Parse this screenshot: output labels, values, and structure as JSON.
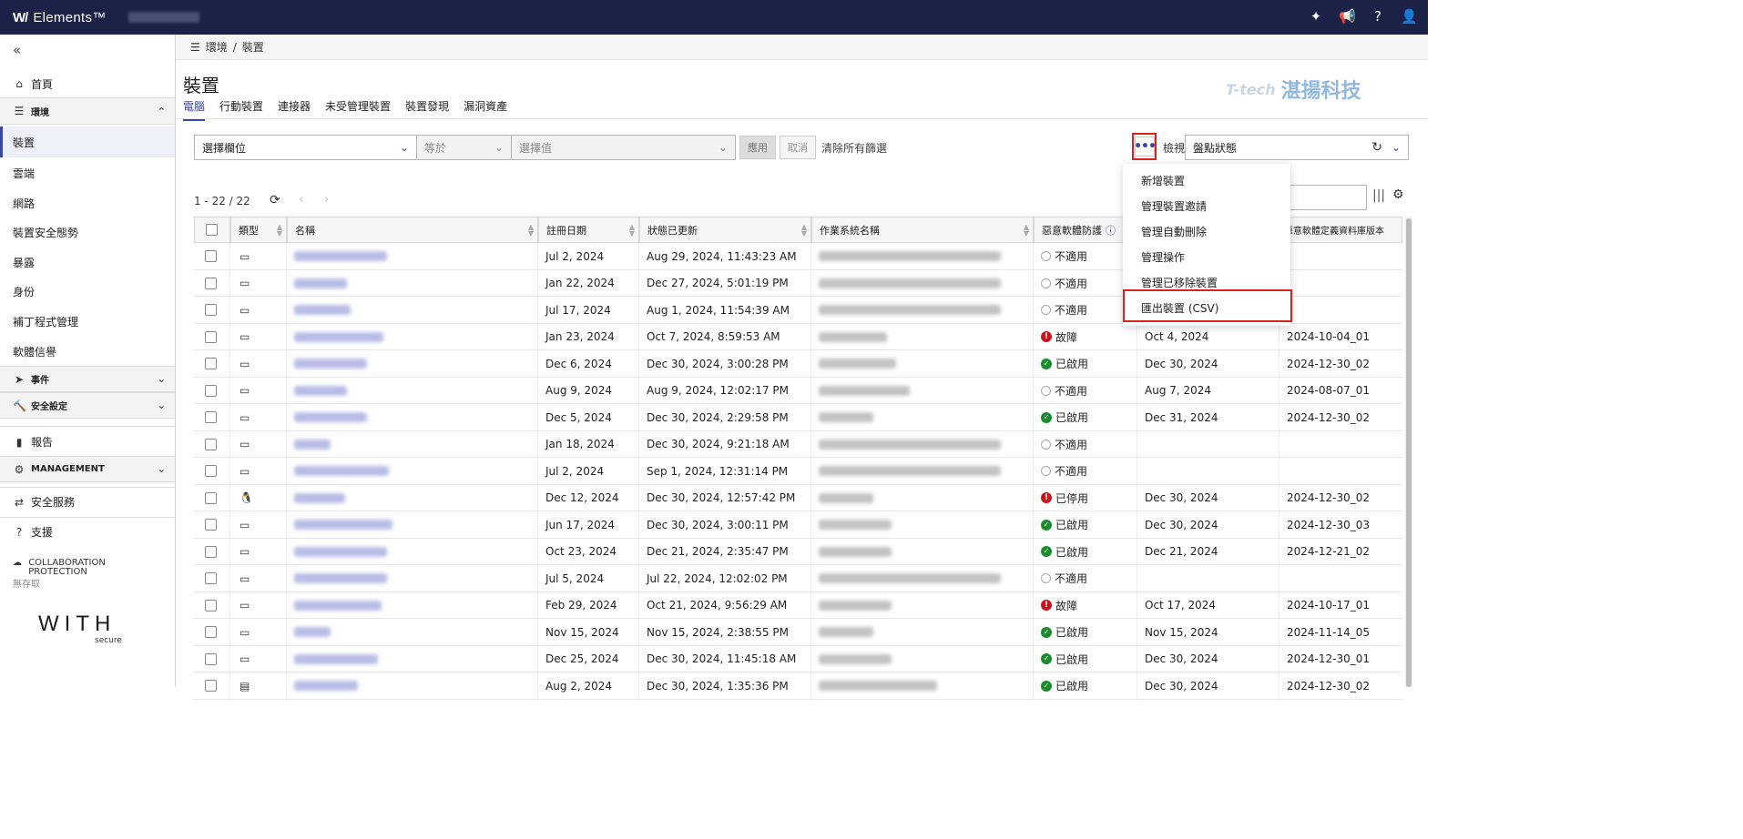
{
  "app": {
    "brand": "Elements™",
    "brand_mark": "W/"
  },
  "topbar_icons": [
    "sparkle-icon",
    "megaphone-icon",
    "help-icon",
    "user-icon"
  ],
  "sidebar": {
    "items": [
      {
        "name": "home",
        "label": "首頁",
        "icon": "⌂"
      },
      {
        "name": "environment",
        "label": "環境",
        "icon": "☰",
        "group": true
      },
      {
        "name": "devices",
        "label": "裝置",
        "active": true
      },
      {
        "name": "cloud",
        "label": "雲端"
      },
      {
        "name": "network",
        "label": "網路"
      },
      {
        "name": "device-security-posture",
        "label": "裝置安全態勢"
      },
      {
        "name": "exposure",
        "label": "暴露"
      },
      {
        "name": "identity",
        "label": "身份"
      },
      {
        "name": "patch-management",
        "label": "補丁程式管理"
      },
      {
        "name": "software-reputation",
        "label": "軟體信譽"
      },
      {
        "name": "events",
        "label": "事件",
        "group": true
      },
      {
        "name": "security-settings",
        "label": "安全設定",
        "group": true
      },
      {
        "name": "reports",
        "label": "報告"
      },
      {
        "name": "management",
        "label": "MANAGEMENT",
        "group": true
      },
      {
        "name": "security-services",
        "label": "安全服務"
      },
      {
        "name": "support",
        "label": "支援"
      }
    ],
    "collab_title": "COLLABORATION PROTECTION",
    "collab_status": "無存取",
    "logo_text": "WITH",
    "logo_sub": "secure"
  },
  "breadcrumb": {
    "root": "環境",
    "sep": "/",
    "current": "裝置"
  },
  "page": {
    "title": "裝置"
  },
  "tabs": [
    {
      "label": "電腦",
      "active": true
    },
    {
      "label": "行動裝置"
    },
    {
      "label": "連接器"
    },
    {
      "label": "未受管理裝置"
    },
    {
      "label": "裝置發現"
    },
    {
      "label": "漏洞資產"
    }
  ],
  "watermark": {
    "en": "T-tech",
    "zh": "湛揚科技"
  },
  "filter": {
    "field_placeholder": "選擇欄位",
    "operator": "等於",
    "value_placeholder": "選擇值",
    "apply": "應用",
    "cancel": "取消",
    "clear": "清除所有篩選"
  },
  "view": {
    "label": "檢視",
    "selected": "盤點狀態"
  },
  "pager": {
    "range": "1 - 22 / 22"
  },
  "more_menu": {
    "items": [
      "新增裝置",
      "管理裝置邀請",
      "管理自動刪除",
      "管理操作",
      "管理已移除裝置",
      "匯出裝置 (CSV)"
    ]
  },
  "table": {
    "headers": {
      "type": "類型",
      "name": "名稱",
      "registered": "註冊日期",
      "updated": "狀態已更新",
      "os": "作業系統名稱",
      "av": "惡意軟體防護",
      "avdb": "惡意軟體定義資料庫版本"
    },
    "rows": [
      {
        "type": "desktop",
        "reg": "Jul 2, 2024",
        "upd": "Aug 29, 2024, 11:43:23 AM",
        "st": "na",
        "stl": "不適用",
        "c1": "",
        "c2": ""
      },
      {
        "type": "desktop",
        "reg": "Jan 22, 2024",
        "upd": "Dec 27, 2024, 5:01:19 PM",
        "st": "na",
        "stl": "不適用",
        "c1": "",
        "c2": ""
      },
      {
        "type": "desktop",
        "reg": "Jul 17, 2024",
        "upd": "Aug 1, 2024, 11:54:39 AM",
        "st": "na",
        "stl": "不適用",
        "c1": "",
        "c2": ""
      },
      {
        "type": "desktop",
        "reg": "Jan 23, 2024",
        "upd": "Oct 7, 2024, 8:59:53 AM",
        "st": "err",
        "stl": "故障",
        "c1": "Oct 4, 2024",
        "c2": "2024-10-04_01"
      },
      {
        "type": "desktop",
        "reg": "Dec 6, 2024",
        "upd": "Dec 30, 2024, 3:00:28 PM",
        "st": "ok",
        "stl": "已啟用",
        "c1": "Dec 30, 2024",
        "c2": "2024-12-30_02"
      },
      {
        "type": "desktop",
        "reg": "Aug 9, 2024",
        "upd": "Aug 9, 2024, 12:02:17 PM",
        "st": "na",
        "stl": "不適用",
        "c1": "Aug 7, 2024",
        "c2": "2024-08-07_01"
      },
      {
        "type": "apple",
        "reg": "Dec 5, 2024",
        "upd": "Dec 30, 2024, 2:29:58 PM",
        "st": "ok",
        "stl": "已啟用",
        "c1": "Dec 31, 2024",
        "c2": "2024-12-30_02"
      },
      {
        "type": "desktop",
        "reg": "Jan 18, 2024",
        "upd": "Dec 30, 2024, 9:21:18 AM",
        "st": "na",
        "stl": "不適用",
        "c1": "",
        "c2": ""
      },
      {
        "type": "desktop",
        "reg": "Jul 2, 2024",
        "upd": "Sep 1, 2024, 12:31:14 PM",
        "st": "na",
        "stl": "不適用",
        "c1": "",
        "c2": ""
      },
      {
        "type": "linux",
        "reg": "Dec 12, 2024",
        "upd": "Dec 30, 2024, 12:57:42 PM",
        "st": "err",
        "stl": "已停用",
        "c1": "Dec 30, 2024",
        "c2": "2024-12-30_02"
      },
      {
        "type": "desktop",
        "reg": "Jun 17, 2024",
        "upd": "Dec 30, 2024, 3:00:11 PM",
        "st": "ok",
        "stl": "已啟用",
        "c1": "Dec 30, 2024",
        "c2": "2024-12-30_03"
      },
      {
        "type": "desktop",
        "reg": "Oct 23, 2024",
        "upd": "Dec 21, 2024, 2:35:47 PM",
        "st": "ok",
        "stl": "已啟用",
        "c1": "Dec 21, 2024",
        "c2": "2024-12-21_02"
      },
      {
        "type": "desktop",
        "reg": "Jul 5, 2024",
        "upd": "Jul 22, 2024, 12:02:02 PM",
        "st": "na",
        "stl": "不適用",
        "c1": "",
        "c2": ""
      },
      {
        "type": "desktop",
        "reg": "Feb 29, 2024",
        "upd": "Oct 21, 2024, 9:56:29 AM",
        "st": "err",
        "stl": "故障",
        "c1": "Oct 17, 2024",
        "c2": "2024-10-17_01"
      },
      {
        "type": "apple",
        "reg": "Nov 15, 2024",
        "upd": "Nov 15, 2024, 2:38:55 PM",
        "st": "ok",
        "stl": "已啟用",
        "c1": "Nov 15, 2024",
        "c2": "2024-11-14_05"
      },
      {
        "type": "desktop",
        "reg": "Dec 25, 2024",
        "upd": "Dec 30, 2024, 11:45:18 AM",
        "st": "ok",
        "stl": "已啟用",
        "c1": "Dec 30, 2024",
        "c2": "2024-12-30_01"
      },
      {
        "type": "server",
        "reg": "Aug 2, 2024",
        "upd": "Dec 30, 2024, 1:35:36 PM",
        "st": "ok",
        "stl": "已啟用",
        "c1": "Dec 30, 2024",
        "c2": "2024-12-30_02"
      }
    ]
  }
}
